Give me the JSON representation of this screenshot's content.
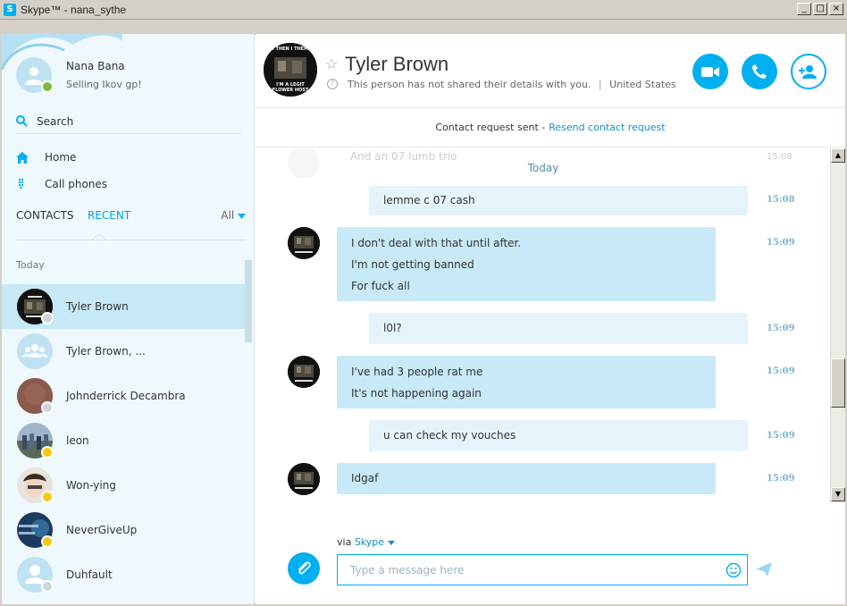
{
  "window": {
    "app_icon": "S",
    "title": "Skype™ - nana_sythe",
    "buttons": [
      "_",
      "□",
      "×"
    ]
  },
  "sidebar": {
    "profile": {
      "name": "Nana Bana",
      "mood": "Selling Ikov gp!",
      "status": "online"
    },
    "search_label": "Search",
    "nav": [
      {
        "label": "Home",
        "icon": "home-icon"
      },
      {
        "label": "Call phones",
        "icon": "dialpad-icon"
      }
    ],
    "tabs": {
      "contacts": "CONTACTS",
      "recent": "RECENT",
      "filter": "All"
    },
    "section_label": "Today",
    "contacts": [
      {
        "name": "Tyler Brown",
        "presence": "unknown",
        "selected": true
      },
      {
        "name": "Tyler Brown, ...",
        "presence": "none",
        "selected": false
      },
      {
        "name": "Johnderrick Decambra",
        "presence": "unknown",
        "selected": false
      },
      {
        "name": "leon",
        "presence": "away",
        "selected": false
      },
      {
        "name": "Won-ying",
        "presence": "away",
        "selected": false
      },
      {
        "name": "NeverGiveUp",
        "presence": "away",
        "selected": false
      },
      {
        "name": "Duhfault",
        "presence": "unknown",
        "selected": false
      }
    ]
  },
  "conversation": {
    "contact_name": "Tyler Brown",
    "contact_info": "This person has not shared their details with you.",
    "contact_location": "United States",
    "avatar_caption_top": "I THEN I THEM",
    "avatar_caption_bottom": "I'M A LEGIT FLOWER HOST",
    "request_text": "Contact request sent -",
    "request_link": "Resend contact request",
    "ghost_message": "And an 07 lumb trio",
    "day_separator": "Today",
    "messages": [
      {
        "direction": "out",
        "lines": [
          "lemme c 07 cash"
        ],
        "time": "15:08"
      },
      {
        "direction": "in",
        "lines": [
          "I don't deal with that until after.",
          "I'm not getting banned",
          "For fuck all"
        ],
        "time": "15:09"
      },
      {
        "direction": "out",
        "lines": [
          "l0l?"
        ],
        "time": "15:09"
      },
      {
        "direction": "in",
        "lines": [
          "I've had 3 people rat me",
          "It's not happening again"
        ],
        "time": "15:09"
      },
      {
        "direction": "out",
        "lines": [
          "u can check my vouches"
        ],
        "time": "15:09"
      },
      {
        "direction": "in",
        "lines": [
          "Idgaf"
        ],
        "time": "15:09"
      }
    ],
    "composer": {
      "via_prefix": "via",
      "via_service": "Skype",
      "placeholder": "Type a message here"
    }
  },
  "colors": {
    "accent": "#00aff0",
    "selected_row": "#c7e8f7",
    "bubble_in": "#c7e9f8",
    "bubble_out": "#e5f4fb"
  }
}
